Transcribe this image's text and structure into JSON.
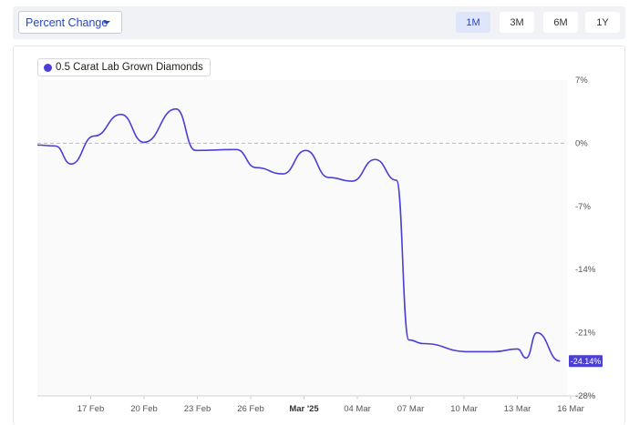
{
  "toolbar": {
    "dropdown_label": "Percent Change",
    "ranges": [
      {
        "label": "1M",
        "active": true
      },
      {
        "label": "3M",
        "active": false
      },
      {
        "label": "6M",
        "active": false
      },
      {
        "label": "1Y",
        "active": false
      }
    ]
  },
  "colors": {
    "series": "#4b3fd6",
    "accent": "#2747b8"
  },
  "chart_data": {
    "type": "line",
    "title": "",
    "xlabel": "",
    "ylabel": "",
    "ylim": [
      -28,
      7
    ],
    "y_ticks": [
      7,
      0,
      -7,
      -14,
      -21,
      -28
    ],
    "y_tick_labels": [
      "7%",
      "0%",
      "-7%",
      "-14%",
      "-21%",
      "-28%"
    ],
    "x_ticks": [
      {
        "day": 3,
        "label": "17 Feb",
        "bold": false
      },
      {
        "day": 6,
        "label": "20 Feb",
        "bold": false
      },
      {
        "day": 9,
        "label": "23 Feb",
        "bold": false
      },
      {
        "day": 12,
        "label": "26 Feb",
        "bold": false
      },
      {
        "day": 15,
        "label": "Mar '25",
        "bold": true
      },
      {
        "day": 18,
        "label": "04 Mar",
        "bold": false
      },
      {
        "day": 21,
        "label": "07 Mar",
        "bold": false
      },
      {
        "day": 24,
        "label": "10 Mar",
        "bold": false
      },
      {
        "day": 27,
        "label": "13 Mar",
        "bold": false
      },
      {
        "day": 30,
        "label": "16 Mar",
        "bold": false
      }
    ],
    "reference_line": 0,
    "legend_position": "top-left",
    "series": [
      {
        "name": "0.5 Carat Lab Grown Diamonds",
        "last_value_label": "-24.14%",
        "x": [
          0,
          1,
          1.9,
          3.2,
          4.7,
          6.0,
          7.8,
          8.9,
          11.2,
          12.3,
          13.8,
          15.1,
          16.4,
          17.7,
          19.0,
          20.2,
          20.9,
          21.7,
          24.2,
          25.7,
          27.0,
          27.5,
          28.1,
          29.4
        ],
        "y": [
          -0.2,
          -0.3,
          -2.3,
          0.8,
          3.2,
          0.1,
          3.8,
          -0.8,
          -0.7,
          -2.7,
          -3.4,
          -0.8,
          -3.8,
          -4.2,
          -1.8,
          -4.1,
          -21.8,
          -22.2,
          -23.1,
          -23.1,
          -22.8,
          -23.8,
          -21.0,
          -24.14
        ]
      }
    ]
  }
}
